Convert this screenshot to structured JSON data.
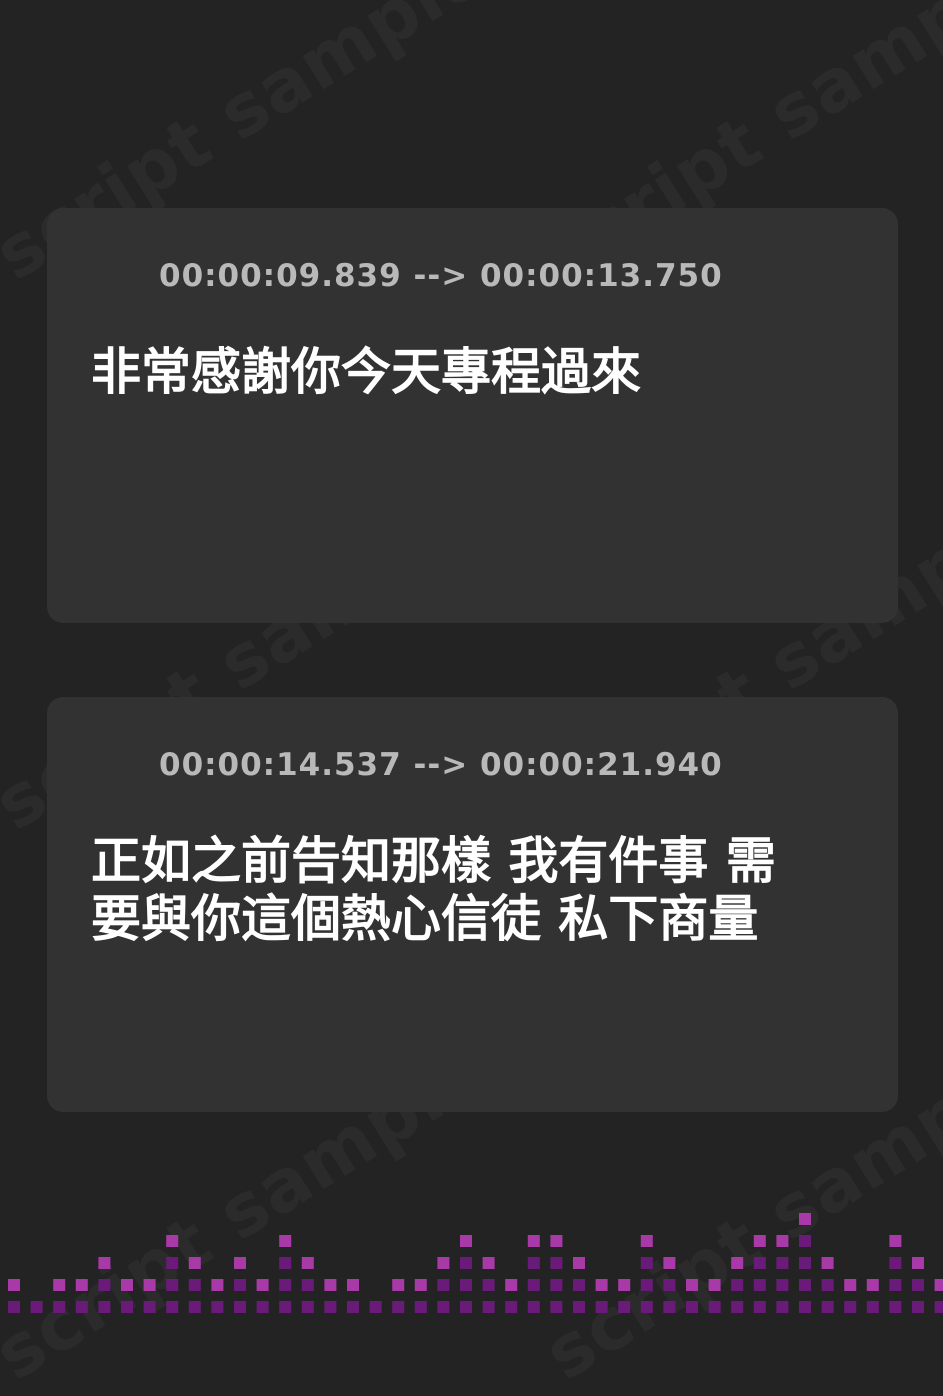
{
  "watermark": {
    "text": "script sample"
  },
  "cards": [
    {
      "timestamp": "00:00:09.839 --> 00:00:13.750",
      "lines": [
        "非常感謝你今天專程過來"
      ]
    },
    {
      "timestamp": "00:00:14.537 --> 00:00:21.940",
      "lines": [
        "正如之前告知那樣 我有件事 需",
        "要與你這個熱心信徒 私下商量"
      ]
    }
  ],
  "icons": {
    "timestamp_icon": "audio-wave-icon"
  },
  "colors": {
    "background": "#232323",
    "card": "#323232",
    "accent_pink": "#e040c8",
    "accent_purple": "#9a2fc0",
    "equalizer_dark": "#6a1b7a",
    "equalizer_light": "#a83aa8",
    "timestamp_text": "#b9b9b9",
    "subtitle_text": "#ffffff"
  }
}
